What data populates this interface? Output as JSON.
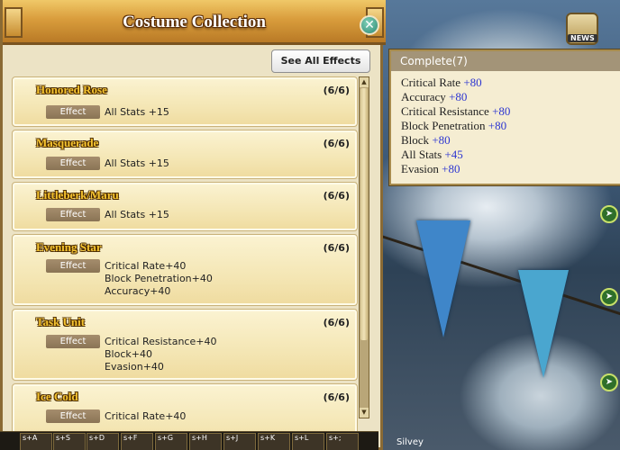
{
  "window": {
    "title": "Costume Collection",
    "close_icon": "close-icon",
    "see_all_label": "See All Effects"
  },
  "cards": [
    {
      "name": "Honored Rose",
      "count": "(6/6)",
      "effect_label": "Effect",
      "effects": [
        "All Stats +15"
      ]
    },
    {
      "name": "Masquerade",
      "count": "(6/6)",
      "effect_label": "Effect",
      "effects": [
        "All Stats +15"
      ]
    },
    {
      "name": "Littleberk/Maru",
      "count": "(6/6)",
      "effect_label": "Effect",
      "effects": [
        "All Stats +15"
      ]
    },
    {
      "name": "Evening Star",
      "count": "(6/6)",
      "effect_label": "Effect",
      "effects": [
        "Critical Rate+40",
        "Block Penetration+40",
        "Accuracy+40"
      ]
    },
    {
      "name": "Task Unit",
      "count": "(6/6)",
      "effect_label": "Effect",
      "effects": [
        "Critical Resistance+40",
        "Block+40",
        "Evasion+40"
      ]
    },
    {
      "name": "Ice Cold",
      "count": "(6/6)",
      "effect_label": "Effect",
      "effects": [
        "Critical Rate+40"
      ]
    }
  ],
  "tooltip": {
    "header": "Complete(7)",
    "rows": [
      {
        "stat": "Critical Rate",
        "value": "+80"
      },
      {
        "stat": "Accuracy",
        "value": "+80"
      },
      {
        "stat": "Critical Resistance",
        "value": "+80"
      },
      {
        "stat": "Block Penetration",
        "value": "+80"
      },
      {
        "stat": "Block",
        "value": "+80"
      },
      {
        "stat": "All Stats",
        "value": "+45"
      },
      {
        "stat": "Evasion",
        "value": "+80"
      }
    ]
  },
  "hud": {
    "news_label": "NEWS",
    "hotbar": [
      "s+A",
      "s+S",
      "s+D",
      "s+F",
      "s+G",
      "s+H",
      "s+J",
      "s+K",
      "s+L",
      "s+;"
    ],
    "player_name": "Silvey"
  },
  "colors": {
    "accent_value": "#2d36d1",
    "title_gold": "#d99d3c",
    "card_name": "#f6c430"
  }
}
